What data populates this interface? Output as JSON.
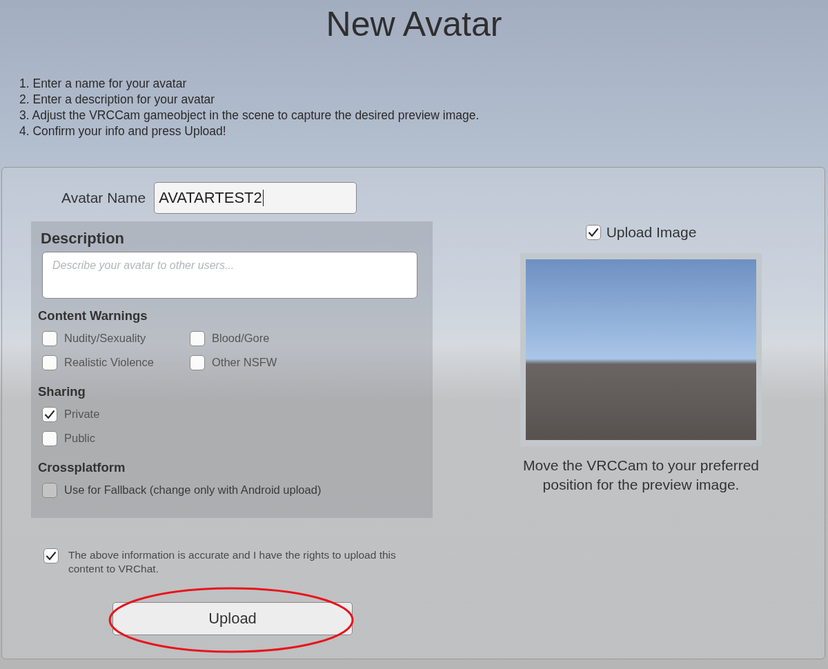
{
  "title": "New Avatar",
  "instructions": [
    "1. Enter a name for your avatar",
    "2. Enter a description for your avatar",
    "3. Adjust the VRCCam gameobject in the scene to capture the desired preview image.",
    "4. Confirm your info and press Upload!"
  ],
  "avatar_name": {
    "label": "Avatar Name",
    "value": "AVATARTEST2"
  },
  "description": {
    "heading": "Description",
    "placeholder": "Describe your avatar to other users..."
  },
  "sections": [
    {
      "heading": "Content Warnings",
      "kind": "grid",
      "options": [
        {
          "label": "Nudity/Sexuality",
          "checked": false,
          "disabled": false
        },
        {
          "label": "Blood/Gore",
          "checked": false,
          "disabled": false
        },
        {
          "label": "Realistic Violence",
          "checked": false,
          "disabled": false
        },
        {
          "label": "Other NSFW",
          "checked": false,
          "disabled": false
        }
      ]
    },
    {
      "heading": "Sharing",
      "kind": "list",
      "options": [
        {
          "label": "Private",
          "checked": true,
          "disabled": false
        },
        {
          "label": "Public",
          "checked": false,
          "disabled": false
        }
      ]
    },
    {
      "heading": "Crossplatform",
      "kind": "list",
      "options": [
        {
          "label": "Use for Fallback (change only with Android upload)",
          "checked": false,
          "disabled": true
        }
      ]
    }
  ],
  "agreement": {
    "label": "The above information is accurate and I have the rights to upload this content to VRChat.",
    "checked": true
  },
  "upload_button": {
    "label": "Upload",
    "highlighted": true
  },
  "upload_image": {
    "label": "Upload Image",
    "checked": true
  },
  "preview_caption": "Move the VRCCam to your preferred position for the preview image."
}
